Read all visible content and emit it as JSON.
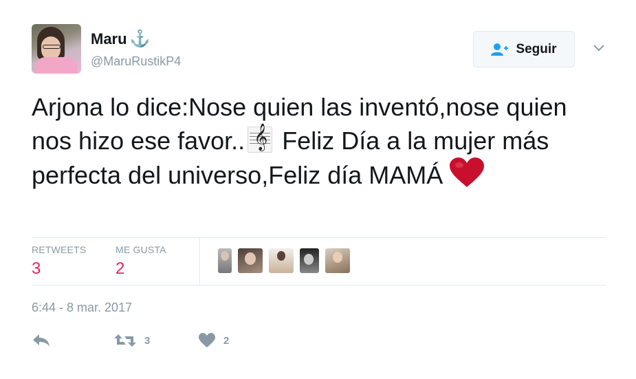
{
  "user": {
    "name": "Maru",
    "name_emoji": "⚓",
    "handle": "@MaruRustikP4"
  },
  "follow_button": {
    "label": "Seguir"
  },
  "tweet": {
    "text_part1": "Arjona lo dice:Nose quien las inventó,nose quien nos hizo ese favor..",
    "text_part2": " Feliz Día a la mujer más perfecta del universo,Feliz día MAMÁ",
    "emoji_1": "music-score-emoji",
    "emoji_2": "red-heart-emoji"
  },
  "stats": {
    "retweets_label": "RETWEETS",
    "retweets_count": "3",
    "likes_label": "ME GUSTA",
    "likes_count": "2"
  },
  "liker_avatars_count": 5,
  "timestamp": "6:44 - 8 mar. 2017",
  "actions": {
    "reply_icon": "reply-icon",
    "retweet_icon": "retweet-icon",
    "retweet_count": "3",
    "like_icon": "heart-icon",
    "like_count": "2"
  },
  "colors": {
    "accent_red": "#e0245e",
    "muted": "#8899a6",
    "anchor_blue": "#2a6fb3",
    "follow_icon_blue": "#1da1f2",
    "heart_red": "#c8102e"
  }
}
